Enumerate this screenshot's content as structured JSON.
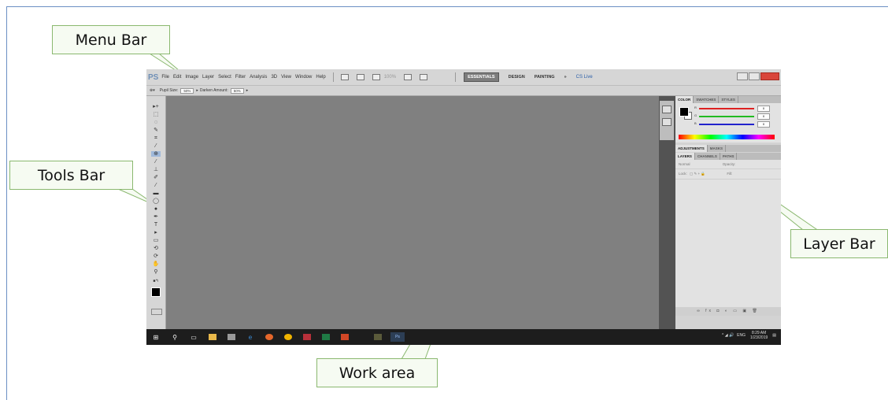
{
  "callouts": {
    "menu_bar": "Menu Bar",
    "tools_bar": "Tools Bar",
    "layer_bar": "Layer Bar",
    "work_area": "Work area"
  },
  "app": {
    "logo": "PS",
    "menu": [
      "File",
      "Edit",
      "Image",
      "Layer",
      "Select",
      "Filter",
      "Analysis",
      "3D",
      "View",
      "Window",
      "Help"
    ],
    "zoom": "100%",
    "workspaces": [
      "ESSENTIALS",
      "DESIGN",
      "PAINTING"
    ],
    "more": "»",
    "cslive": "CS Live"
  },
  "options": {
    "pupil_label": "Pupil Size:",
    "pupil_value": "50%",
    "darken_label": "Darken Amount:",
    "darken_value": "50%"
  },
  "panels": {
    "color_tabs": [
      "COLOR",
      "SWATCHES",
      "STYLES"
    ],
    "channels": [
      "R",
      "G",
      "B"
    ],
    "channel_values": [
      "0",
      "0",
      "0"
    ],
    "adj_tabs": [
      "ADJUSTMENTS",
      "MASKS"
    ],
    "layer_tabs": [
      "LAYERS",
      "CHANNELS",
      "PATHS"
    ],
    "blend_mode": "Normal",
    "opacity_label": "Opacity:",
    "lock_label": "Lock:",
    "fill_label": "Fill:"
  },
  "taskbar": {
    "time": "8:29 AM",
    "date": "1/23/2019",
    "lang": "ENG",
    "ps_label": "Ps"
  },
  "colors": {
    "callout_border": "#8ab86f",
    "callout_fill": "#f6fbf2",
    "workspace": "#808080",
    "frame": "#6b8fc4"
  }
}
